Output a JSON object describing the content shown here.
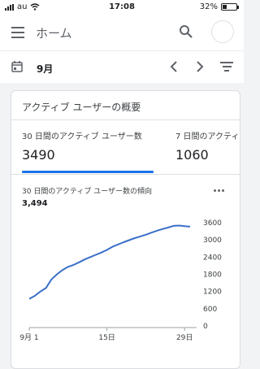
{
  "status_bar": {
    "carrier": "au",
    "time": "17:08",
    "battery_percent": "32%",
    "battery_level": 0.32
  },
  "app_bar": {
    "title": "ホーム",
    "icons": [
      "menu-icon",
      "search-icon",
      "avatar"
    ]
  },
  "date_bar": {
    "label": "9月",
    "icons": [
      "calendar-icon",
      "chevron-left-icon",
      "chevron-right-icon",
      "filter-icon"
    ]
  },
  "card": {
    "title": "アクティブ ユーザーの概要",
    "tabs": [
      {
        "label": "30 日間のアクティブ ユーザー数",
        "value": "3490",
        "selected": true
      },
      {
        "label": "7 日間のアクティブ",
        "value": "1060",
        "selected": false
      }
    ],
    "chart_title": "30 日間のアクティブ ユーザー数の傾向",
    "chart_value": "3,494"
  },
  "chart_data": {
    "type": "line",
    "title": "30 日間のアクティブ ユーザー数の傾向",
    "x_ticks": [
      "9月 1",
      "15日",
      "29日"
    ],
    "x_tick_days": [
      1,
      15,
      29
    ],
    "y_ticks": [
      "3600",
      "3000",
      "2400",
      "1800",
      "1200",
      "600",
      "0"
    ],
    "ylim": [
      0,
      3600
    ],
    "xlim": [
      1,
      30
    ],
    "series": [
      {
        "color": "#3a6fc8",
        "x": [
          1,
          2,
          3,
          4,
          5,
          6,
          7,
          8,
          9,
          10,
          11,
          12,
          13,
          14,
          15,
          16,
          17,
          18,
          19,
          20,
          21,
          22,
          23,
          24,
          25,
          26,
          27,
          28,
          29,
          30
        ],
        "values": [
          940,
          1050,
          1200,
          1320,
          1620,
          1800,
          1950,
          2060,
          2130,
          2220,
          2320,
          2400,
          2480,
          2560,
          2650,
          2760,
          2840,
          2920,
          2990,
          3060,
          3120,
          3180,
          3250,
          3320,
          3380,
          3430,
          3490,
          3500,
          3480,
          3460
        ]
      }
    ],
    "grid": false
  }
}
